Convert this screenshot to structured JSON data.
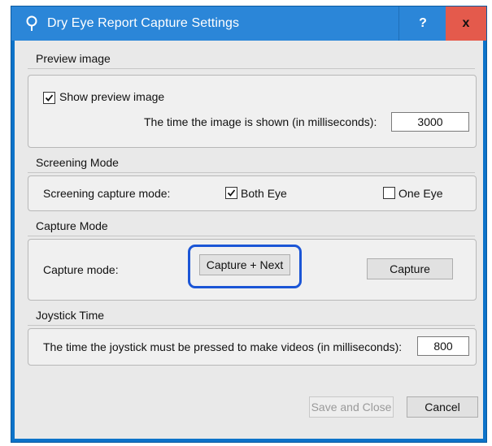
{
  "window": {
    "title": "Dry Eye Report Capture Settings",
    "help_label": "?",
    "close_label": "x"
  },
  "preview": {
    "section_title": "Preview image",
    "show_preview_label": "Show preview image",
    "show_preview_checked": true,
    "time_label": "The time the image is shown (in milliseconds):",
    "time_value": "3000"
  },
  "screening": {
    "section_title": "Screening Mode",
    "mode_label": "Screening capture mode:",
    "both_eye_label": "Both Eye",
    "both_eye_checked": true,
    "one_eye_label": "One Eye",
    "one_eye_checked": false
  },
  "capture": {
    "section_title": "Capture Mode",
    "mode_label": "Capture mode:",
    "capture_next_label": "Capture + Next",
    "capture_label": "Capture"
  },
  "joystick": {
    "section_title": "Joystick Time",
    "time_label": "The time the joystick must be pressed to make videos (in milliseconds):",
    "time_value": "800"
  },
  "footer": {
    "save_close_label": "Save and Close",
    "cancel_label": "Cancel"
  },
  "colors": {
    "titlebar": "#2b86d8",
    "close_button": "#e45a4c",
    "highlight_ring": "#1b55d6",
    "dialog_bg": "#e9e9e9"
  }
}
